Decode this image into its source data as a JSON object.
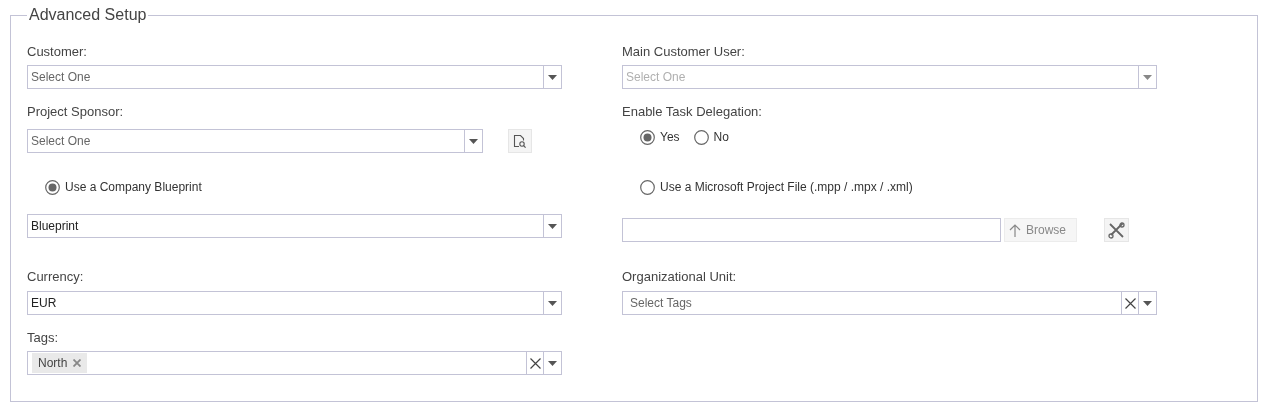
{
  "section": {
    "title": "Advanced Setup"
  },
  "rows": [
    {
      "left": {
        "kind": "select",
        "label": "Customer:",
        "placeholder": "Select One"
      },
      "right": {
        "kind": "select",
        "label": "Main Customer User:",
        "placeholder": "Select One",
        "disabled": true
      }
    },
    {
      "left": {
        "kind": "lookup_select",
        "label": "Project Sponsor:",
        "placeholder": "Select One"
      },
      "right": {
        "kind": "radio_group",
        "label": "Enable Task Delegation:",
        "options": [
          {
            "label": "Yes",
            "selected": true
          },
          {
            "label": "No",
            "selected": false
          }
        ]
      }
    },
    {
      "left": {
        "kind": "radio",
        "label": "Use a Company Blueprint",
        "selected": true
      },
      "right": {
        "kind": "radio",
        "label": "Use a Microsoft Project File (.mpp / .mpx / .xml)",
        "selected": false
      }
    },
    {
      "left": {
        "kind": "select",
        "value": "Blueprint"
      },
      "right": {
        "kind": "file_upload",
        "button": "Browse"
      }
    },
    {
      "left": {
        "kind": "select",
        "label": "Currency:",
        "value": "EUR"
      },
      "right": {
        "kind": "tag_select",
        "label": "Organizational Unit:",
        "placeholder": "Select Tags"
      }
    },
    {
      "left": {
        "kind": "tag_select",
        "label": "Tags:",
        "tags": [
          "North"
        ]
      },
      "right": null
    }
  ]
}
